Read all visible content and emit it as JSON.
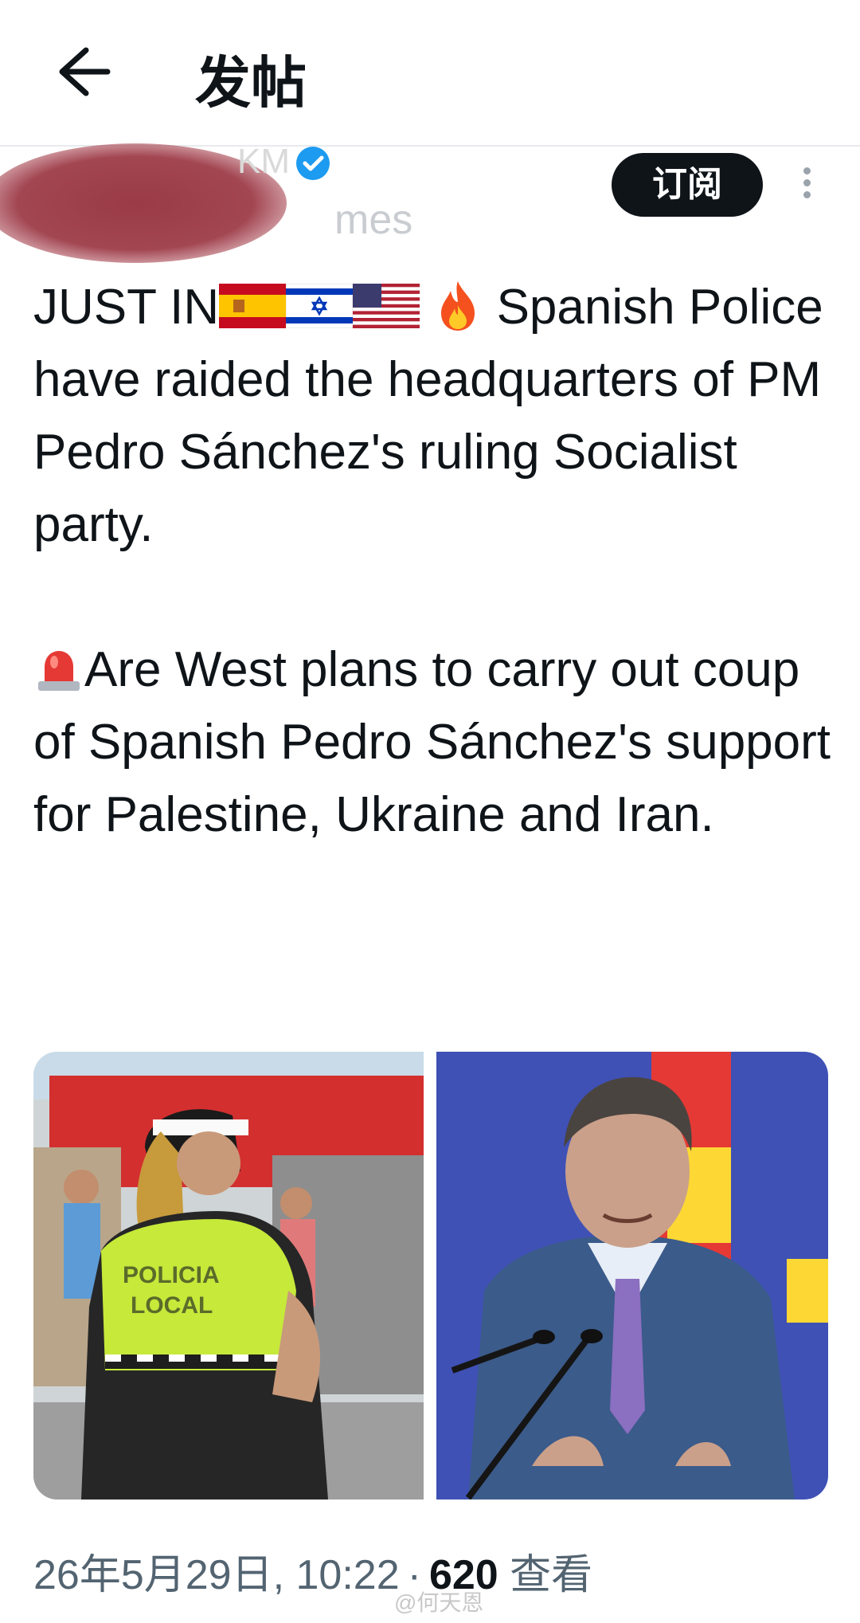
{
  "header": {
    "title": "发帖",
    "back_icon": "arrow-left-icon"
  },
  "author": {
    "name_visible": "KM",
    "handle_visible": "mes",
    "subscribe_label": "订阅",
    "verified_color": "#1d9bf0"
  },
  "post": {
    "line1_prefix": "JUST IN",
    "line1_suffix": " Spanish Police have raided the headquarters of PM Pedro Sánchez's ruling Socialist party.",
    "para2": "Are West plans to carry out coup of Spanish Pedro Sánchez's support for Palestine, Ukraine and Iran.",
    "flags": [
      "spain-flag-icon",
      "israel-flag-icon",
      "usa-flag-icon"
    ],
    "emoji": [
      "fire-icon",
      "siren-icon"
    ]
  },
  "media": {
    "left_label_line1": "POLICIA",
    "left_label_line2": "LOCAL"
  },
  "meta": {
    "date": "26年5月29日, 10:22",
    "separator": "·",
    "views_count": "620",
    "views_label": "查看"
  },
  "watermark": {
    "text": "@何天恩"
  },
  "colors": {
    "text": "#0f1419",
    "secondary": "#536471",
    "accent": "#1d9bf0"
  }
}
